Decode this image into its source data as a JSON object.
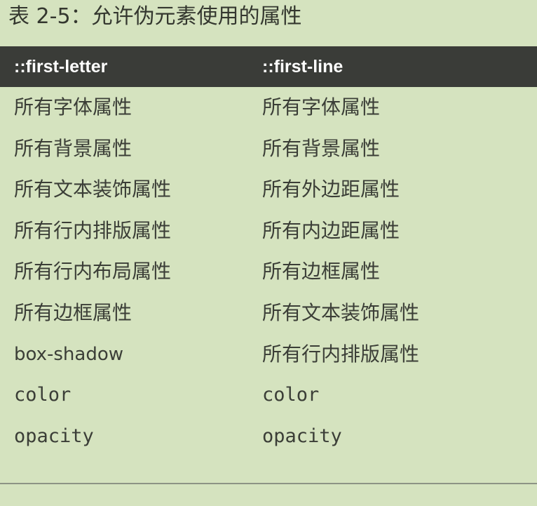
{
  "caption": "表 2-5：允许伪元素使用的属性",
  "table": {
    "headers": [
      "::first-letter",
      "::first-line"
    ],
    "rows": [
      [
        "所有字体属性",
        "所有字体属性"
      ],
      [
        "所有背景属性",
        "所有背景属性"
      ],
      [
        "所有文本装饰属性",
        "所有外边距属性"
      ],
      [
        "所有行内排版属性",
        "所有内边距属性"
      ],
      [
        "所有行内布局属性",
        "所有边框属性"
      ],
      [
        "所有边框属性",
        "所有文本装饰属性"
      ],
      [
        "box-shadow",
        "所有行内排版属性"
      ],
      [
        "color",
        "color"
      ],
      [
        "opacity",
        "opacity"
      ]
    ]
  },
  "colors": {
    "page_background": "#d5e3bf",
    "header_background": "#3a3c38",
    "header_text": "#ffffff",
    "body_text": "#3b3e37"
  }
}
